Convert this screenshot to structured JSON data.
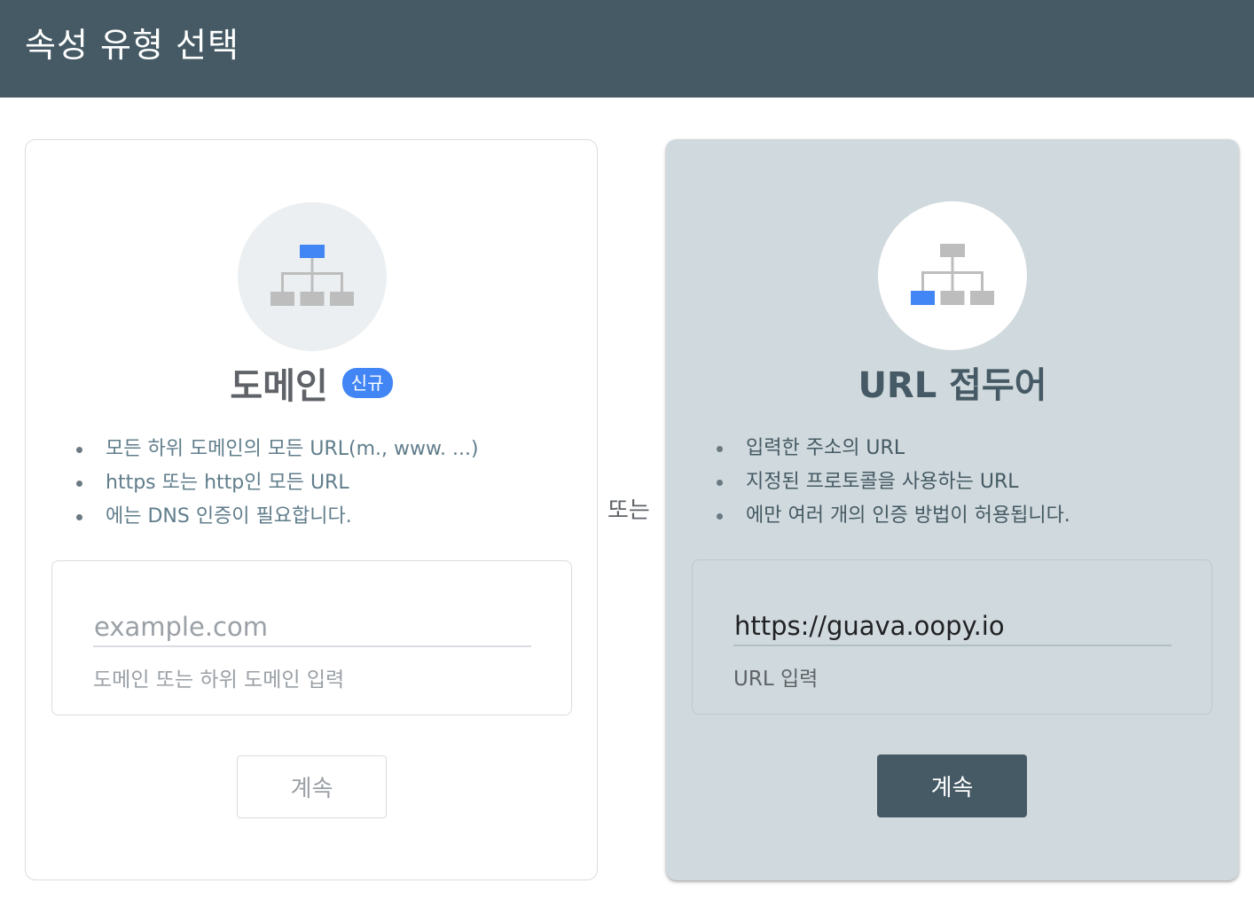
{
  "header": {
    "title": "속성 유형 선택"
  },
  "separator": {
    "label": "또는"
  },
  "domain_card": {
    "icon": "sitemap-icon",
    "title": "도메인",
    "badge": "신규",
    "bullets": [
      "모든 하위 도메인의 모든 URL(m., www. ...)",
      "https 또는 http인 모든 URL",
      "에는 DNS 인증이 필요합니다."
    ],
    "input": {
      "placeholder": "example.com",
      "value": ""
    },
    "hint": "도메인 또는 하위 도메인 입력",
    "button": "계속",
    "button_state": "disabled"
  },
  "url_prefix_card": {
    "icon": "sitemap-icon",
    "title": "URL 접두어",
    "bullets": [
      "입력한 주소의 URL",
      "지정된 프로토콜을 사용하는 URL",
      "에만 여러 개의 인증 방법이 허용됩니다."
    ],
    "input": {
      "placeholder": "",
      "value": "https://guava.oopy.io"
    },
    "hint": "URL 입력",
    "button": "계속",
    "button_state": "enabled",
    "selected": true
  },
  "colors": {
    "header_bg": "#455a64",
    "selected_card_bg": "#d0d9dd",
    "accent": "#4285f4",
    "icon_gray": "#bdbdbd"
  }
}
